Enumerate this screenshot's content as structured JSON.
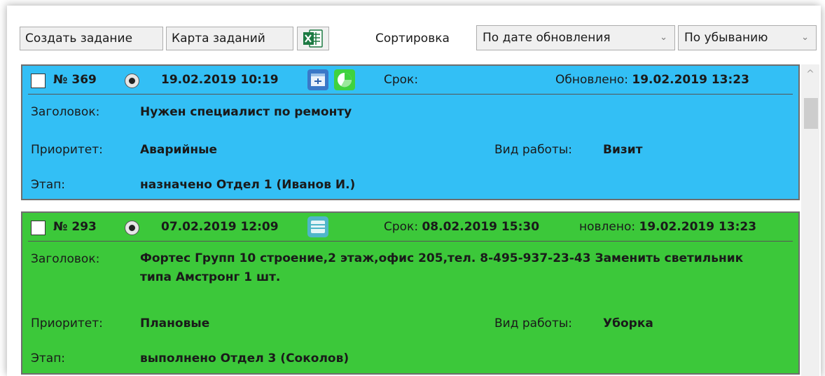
{
  "toolbar": {
    "create_label": "Создать задание",
    "map_label": "Карта заданий",
    "sort_label": "Сортировка",
    "sort_field": "По дате обновления",
    "sort_order": "По убыванию",
    "chevron": "⌄",
    "excel_icon": "excel-icon"
  },
  "tasks": [
    {
      "number": "№ 369",
      "created": "19.02.2019 10:19",
      "deadline_label": "Срок:",
      "deadline_value": "",
      "updated_label": "Обновлено:",
      "updated_value": "19.02.2019 13:23",
      "title_label": "Заголовок:",
      "title": "Нужен специалист по ремонту",
      "priority_label": "Приоритет:",
      "priority": "Аварийные",
      "work_type_label": "Вид работы:",
      "work_type": "Визит",
      "stage_label": "Этап:",
      "stage": "назначено Отдел 1 (Иванов И.)",
      "color": "#33bff5"
    },
    {
      "number": "№ 293",
      "created": "07.02.2019 12:09",
      "deadline_label": "Срок:",
      "deadline_value": "08.02.2019 15:30",
      "updated_label": "новлено:",
      "updated_value": "19.02.2019 13:23",
      "title_label": "Заголовок:",
      "title": "Фортес Групп 10 строение,2 этаж,офис 205,тел. 8-495-937-23-43 Заменить светильник типа Амстронг 1 шт.",
      "priority_label": "Приоритет:",
      "priority": "Плановые",
      "work_type_label": "Вид работы:",
      "work_type": "Уборка",
      "stage_label": "Этап:",
      "stage": "выполнено Отдел 3 (Соколов)",
      "color": "#3cc83a"
    }
  ],
  "scrollbar": {
    "up_arrow": "^"
  }
}
